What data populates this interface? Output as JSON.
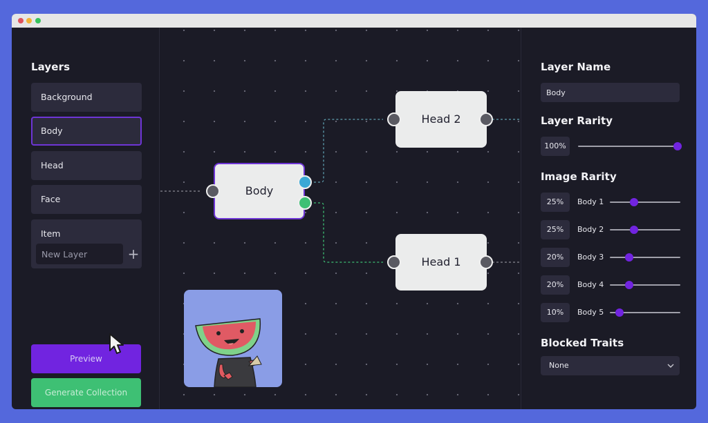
{
  "window": {
    "traffic_lights": [
      "close",
      "minimize",
      "maximize"
    ],
    "colors": {
      "background": "#5468dc",
      "panel": "#1b1b26",
      "accent": "#7124e0",
      "success": "#3ec074",
      "port_blue": "#39a8d6"
    }
  },
  "layers_panel": {
    "title": "Layers",
    "items": [
      {
        "label": "Background",
        "selected": false
      },
      {
        "label": "Body",
        "selected": true
      },
      {
        "label": "Head",
        "selected": false
      },
      {
        "label": "Face",
        "selected": false
      },
      {
        "label": "Item",
        "selected": false
      }
    ],
    "new_layer": {
      "placeholder": "New Layer",
      "value": "",
      "add_icon": "plus-icon"
    },
    "preview_button": "Preview",
    "generate_button": "Generate Collection"
  },
  "canvas": {
    "nodes": [
      {
        "id": "body",
        "label": "Body",
        "selected": true
      },
      {
        "id": "head2",
        "label": "Head 2",
        "selected": false
      },
      {
        "id": "head1",
        "label": "Head 1",
        "selected": false
      }
    ],
    "connections": [
      {
        "from": "body",
        "to": "head2",
        "color": "#5fa0b0"
      },
      {
        "from": "body",
        "to": "head1",
        "color": "#3ec074"
      }
    ],
    "preview_image": "watermelon-character"
  },
  "properties_panel": {
    "layer_name_title": "Layer Name",
    "layer_name_value": "Body",
    "layer_rarity_title": "Layer Rarity",
    "layer_rarity": {
      "label": "100%",
      "value": 100
    },
    "image_rarity_title": "Image Rarity",
    "image_rarity": [
      {
        "name": "Body 1",
        "label": "25%",
        "value": 25
      },
      {
        "name": "Body 2",
        "label": "25%",
        "value": 25
      },
      {
        "name": "Body 3",
        "label": "20%",
        "value": 20
      },
      {
        "name": "Body 4",
        "label": "20%",
        "value": 20
      },
      {
        "name": "Body 5",
        "label": "10%",
        "value": 10
      }
    ],
    "blocked_traits_title": "Blocked Traits",
    "blocked_traits_value": "None"
  }
}
